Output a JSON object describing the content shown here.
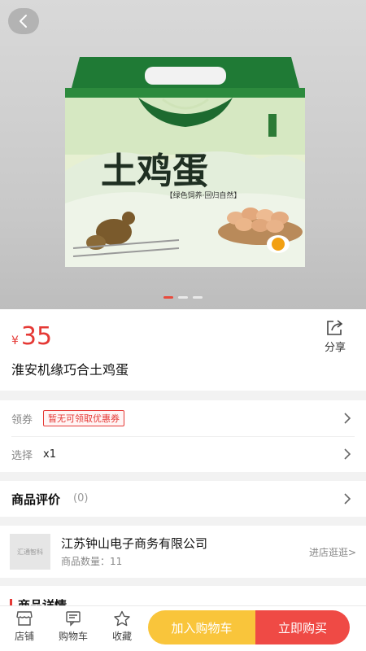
{
  "product": {
    "currency": "¥",
    "price": "35",
    "title": "淮安机缘巧合土鸡蛋",
    "image": {
      "box_title": "土鸡蛋",
      "box_subtitle": "【绿色饲养·回归自然】",
      "slides": 3,
      "active_slide": 1
    }
  },
  "share": {
    "label": "分享"
  },
  "options": {
    "coupon_label": "领券",
    "coupon_badge": "暂无可领取优惠券",
    "select_label": "选择",
    "select_value": "x1"
  },
  "review": {
    "title": "商品评价",
    "count": "(0)"
  },
  "shop": {
    "logo_text": "汇通智科",
    "name": "江苏钟山电子商务有限公司",
    "count": "商品数量：11",
    "enter": "进店逛逛>"
  },
  "detail": {
    "title": "商品详情"
  },
  "bottom": {
    "store": "店铺",
    "cart": "购物车",
    "favorite": "收藏",
    "add_to_cart": "加入购物车",
    "buy_now": "立即购买"
  },
  "colors": {
    "accent": "#e53935",
    "cart_btn": "#f9c53b",
    "buy_btn": "#ef4a45"
  }
}
